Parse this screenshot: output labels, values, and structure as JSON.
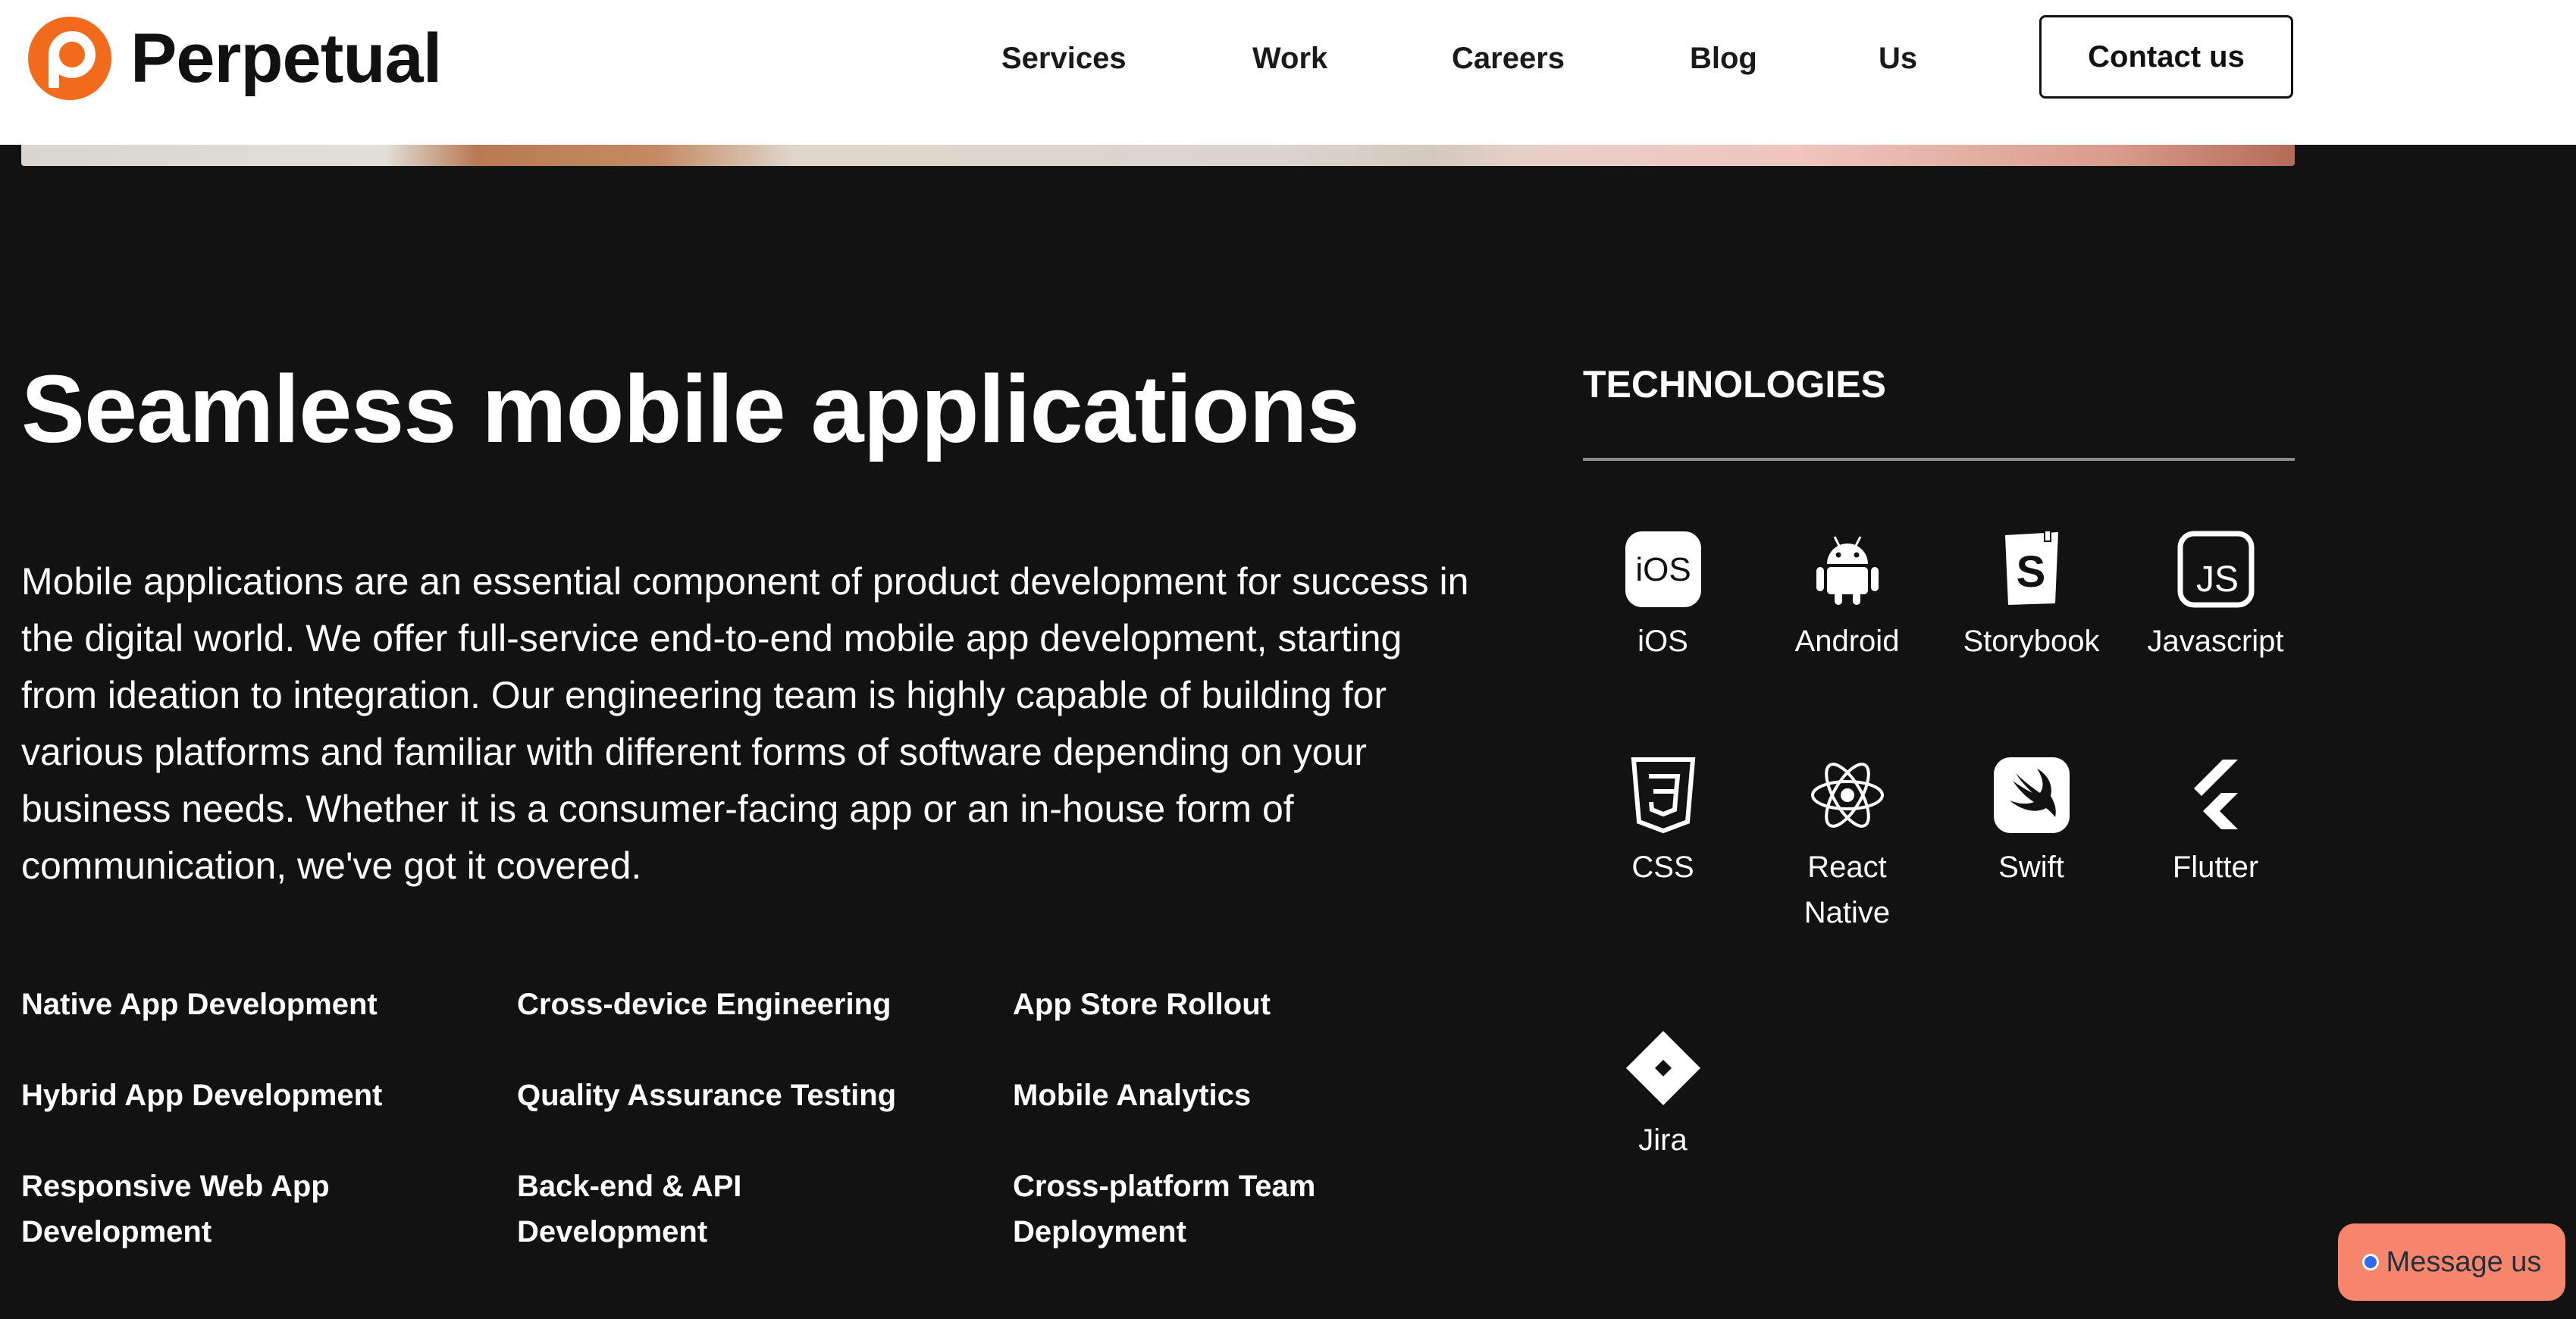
{
  "header": {
    "brand": "Perpetual",
    "nav": [
      "Services",
      "Work",
      "Careers",
      "Blog",
      "Us"
    ],
    "contact_label": "Contact us"
  },
  "main": {
    "title": "Seamless mobile applications",
    "intro": "Mobile applications are an essential component of product development for success in the digital world. We offer full-service end-to-end mobile app development, starting from ideation to integration. Our engineering team is highly capable of building for various platforms and familiar with different forms of software depending on your business needs. Whether it is a consumer-facing app or an in-house form of communication, we've got it covered.",
    "services": [
      "Native App Development",
      "Cross-device Engineering",
      "App Store Rollout",
      "Hybrid App Development",
      "Quality Assurance Testing",
      "Mobile Analytics",
      "Responsive Web App Development",
      "Back-end & API Development",
      "Cross-platform Team Deployment"
    ]
  },
  "technologies": {
    "heading": "TECHNOLOGIES",
    "items": [
      {
        "label": "iOS",
        "icon": "ios-icon"
      },
      {
        "label": "Android",
        "icon": "android-icon"
      },
      {
        "label": "Storybook",
        "icon": "storybook-icon"
      },
      {
        "label": "Javascript",
        "icon": "javascript-icon"
      },
      {
        "label": "CSS",
        "icon": "css-icon"
      },
      {
        "label": "React Native",
        "icon": "react-icon"
      },
      {
        "label": "Swift",
        "icon": "swift-icon"
      },
      {
        "label": "Flutter",
        "icon": "flutter-icon"
      },
      {
        "label": "Jira",
        "icon": "jira-icon"
      }
    ]
  },
  "widget": {
    "message_label": "Message us"
  },
  "colors": {
    "brand_orange": "#f26b1d",
    "background": "#121212",
    "message_button": "#f5856b"
  }
}
